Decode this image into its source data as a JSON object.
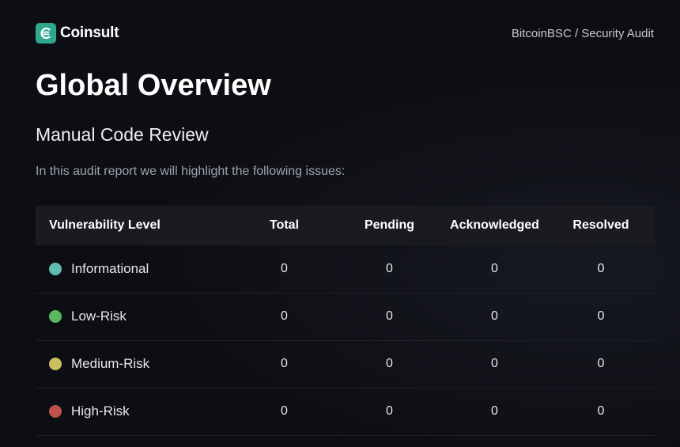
{
  "header": {
    "brand_name": "Coinsult",
    "logo_icon": "coinsult-logo-icon",
    "breadcrumb": "BitcoinBSC / Security Audit"
  },
  "main": {
    "title": "Global Overview",
    "section_title": "Manual Code Review",
    "intro": "In this audit report we will highlight the following issues:"
  },
  "table": {
    "columns": [
      "Vulnerability Level",
      "Total",
      "Pending",
      "Acknowledged",
      "Resolved"
    ],
    "rows": [
      {
        "level": "Informational",
        "color": "#5fbcb3",
        "total": "0",
        "pending": "0",
        "acknowledged": "0",
        "resolved": "0"
      },
      {
        "level": "Low-Risk",
        "color": "#5cb85c",
        "total": "0",
        "pending": "0",
        "acknowledged": "0",
        "resolved": "0"
      },
      {
        "level": "Medium-Risk",
        "color": "#c9bf5f",
        "total": "0",
        "pending": "0",
        "acknowledged": "0",
        "resolved": "0"
      },
      {
        "level": "High-Risk",
        "color": "#c0504d",
        "total": "0",
        "pending": "0",
        "acknowledged": "0",
        "resolved": "0"
      }
    ]
  },
  "colors": {
    "background": "#0d0e13",
    "brand_accent": "#2fa88f",
    "table_header_bg": "#1a1b21"
  }
}
